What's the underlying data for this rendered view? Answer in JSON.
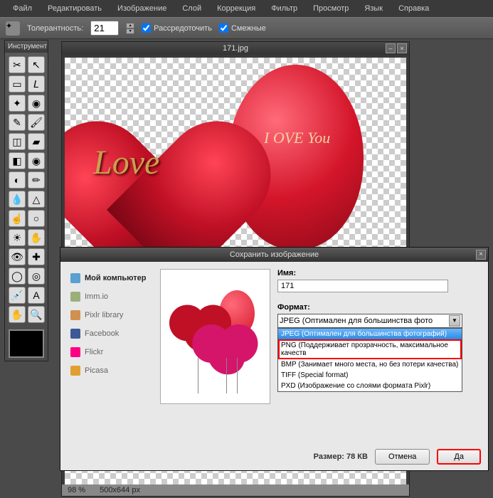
{
  "menu": [
    "Файл",
    "Редактировать",
    "Изображение",
    "Слой",
    "Коррекция",
    "Фильтр",
    "Просмотр",
    "Язык",
    "Справка"
  ],
  "toolbar": {
    "tolerance_label": "Толерантность:",
    "tolerance_value": "21",
    "feather_label": "Рассредоточить",
    "contiguous_label": "Смежные"
  },
  "toolbox": {
    "title": "Инструмент",
    "tools": [
      {
        "name": "crop",
        "g": "✂"
      },
      {
        "name": "move",
        "g": "↖"
      },
      {
        "name": "marquee",
        "g": "▭"
      },
      {
        "name": "lasso",
        "g": "𝘓"
      },
      {
        "name": "wand",
        "g": "✦"
      },
      {
        "name": "quick-select",
        "g": "◉"
      },
      {
        "name": "pencil",
        "g": "✎"
      },
      {
        "name": "brush",
        "g": "🖌"
      },
      {
        "name": "eraser",
        "g": "◫"
      },
      {
        "name": "bucket",
        "g": "▰"
      },
      {
        "name": "gradient",
        "g": "◧"
      },
      {
        "name": "clone",
        "g": "◉"
      },
      {
        "name": "replace",
        "g": "◐"
      },
      {
        "name": "draw",
        "g": "✏"
      },
      {
        "name": "blur",
        "g": "💧"
      },
      {
        "name": "sharpen",
        "g": "△"
      },
      {
        "name": "smudge",
        "g": "☝"
      },
      {
        "name": "sponge",
        "g": "○"
      },
      {
        "name": "dodge",
        "g": "☀"
      },
      {
        "name": "burn",
        "g": "✋"
      },
      {
        "name": "redeye",
        "g": "👁"
      },
      {
        "name": "spot",
        "g": "✚"
      },
      {
        "name": "bloat",
        "g": "◯"
      },
      {
        "name": "pinch",
        "g": "◎"
      },
      {
        "name": "picker",
        "g": "💉"
      },
      {
        "name": "type",
        "g": "A"
      },
      {
        "name": "hand",
        "g": "✋"
      },
      {
        "name": "zoom",
        "g": "🔍"
      }
    ]
  },
  "canvas": {
    "title": "171.jpg",
    "love_text": "Love"
  },
  "statusbar": {
    "zoom": "98  %",
    "dims": "500x644 px"
  },
  "dialog": {
    "title": "Сохранить изображение",
    "destinations": [
      {
        "label": "Мой компьютер",
        "color": "#5aa0d0",
        "active": true
      },
      {
        "label": "Imm.io",
        "color": "#9ab07a"
      },
      {
        "label": "Pixlr library",
        "color": "#d09050"
      },
      {
        "label": "Facebook",
        "color": "#3b5998"
      },
      {
        "label": "Flickr",
        "color": "#ff0084"
      },
      {
        "label": "Picasa",
        "color": "#e0a030"
      }
    ],
    "name_label": "Имя:",
    "name_value": "171",
    "format_label": "Формат:",
    "format_selected": "JPEG (Оптимален для большинства фото",
    "format_options": [
      {
        "text": "JPEG (Оптимален для большинства фотографий)",
        "sel": true
      },
      {
        "text": "PNG (Поддерживает прозрачность, максимальное качеств",
        "hl": true
      },
      {
        "text": "BMP (Занимает много места, но без потери качества)"
      },
      {
        "text": "TIFF (Special format)"
      },
      {
        "text": "PXD (Изображение со слоями формата Pixlr)"
      }
    ],
    "size_label": "Размер: 78 КВ",
    "cancel": "Отмена",
    "ok": "Да"
  }
}
